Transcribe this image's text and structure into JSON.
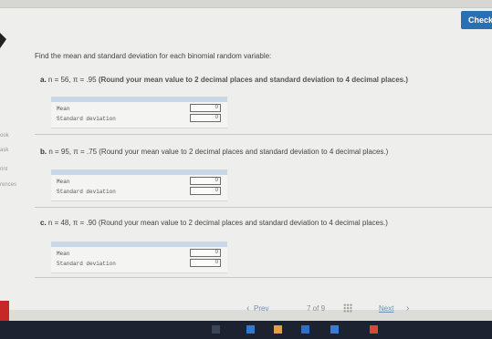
{
  "header": {
    "check_label": "Check"
  },
  "sidebar": {
    "items": [
      "ook",
      "ask",
      "rint",
      "rences"
    ]
  },
  "question": {
    "instruction": "Find the mean and standard deviation for each binomial random variable:",
    "parts": [
      {
        "letter": "a.",
        "params": "n = 56, π = .95",
        "note": "(Round your mean value to 2 decimal places and standard deviation to 4 decimal places.)",
        "rows": [
          {
            "label": "Mean",
            "value": "0"
          },
          {
            "label": "Standard deviation",
            "value": "0"
          }
        ]
      },
      {
        "letter": "b.",
        "params": "n = 95, π = .75",
        "note": "(Round your mean value to 2 decimal places and standard deviation to 4 decimal places.)",
        "rows": [
          {
            "label": "Mean",
            "value": "0"
          },
          {
            "label": "Standard deviation",
            "value": "0"
          }
        ]
      },
      {
        "letter": "c.",
        "params": "n = 48, π = .90",
        "note": "(Round your mean value to 2 decimal places and standard deviation to 4 decimal places.)",
        "rows": [
          {
            "label": "Mean",
            "value": "0"
          },
          {
            "label": "Standard deviation",
            "value": "0"
          }
        ]
      }
    ]
  },
  "nav": {
    "prev_label": "Prev",
    "position": "7 of 9",
    "next_label": "Next"
  },
  "icons": {
    "prev": "chevron-left-icon",
    "next": "chevron-right-icon",
    "grid": "grid-icon"
  },
  "colors": {
    "check_button": "#2a6fb0",
    "accent_tab": "#c62828",
    "answer_header": "#c9d8e6"
  }
}
